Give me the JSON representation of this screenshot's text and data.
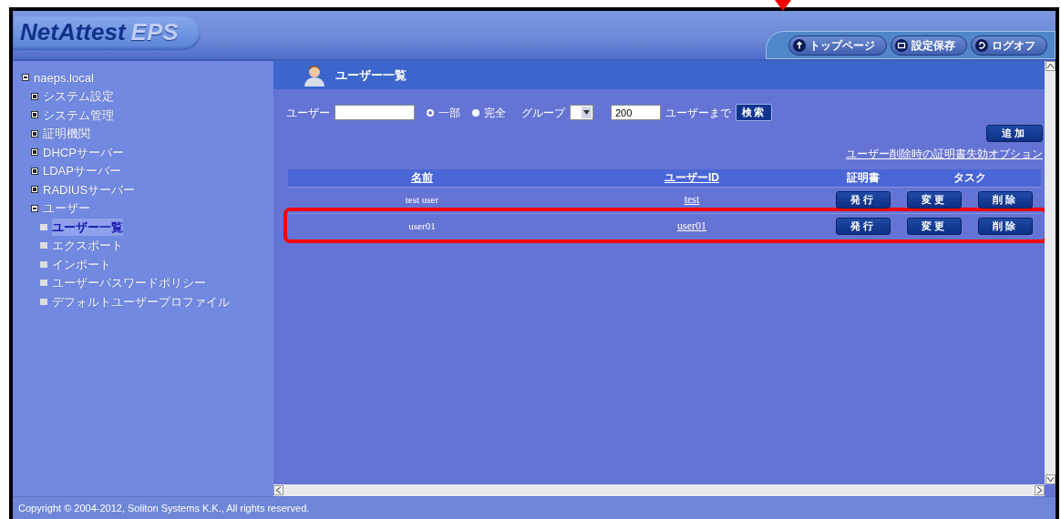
{
  "header": {
    "logo": {
      "main": "NetAttest",
      "sub": "EPS"
    },
    "nav_buttons": [
      {
        "label": "トップページ"
      },
      {
        "label": "設定保存"
      },
      {
        "label": "ログオフ"
      }
    ]
  },
  "sidebar": {
    "tree": [
      {
        "label": "naeps.local",
        "expanded": true,
        "selected": false,
        "children": [
          {
            "label": "システム設定",
            "expanded": false,
            "selected": false
          },
          {
            "label": "システム管理",
            "expanded": false,
            "selected": false
          },
          {
            "label": "証明機関",
            "expanded": false,
            "selected": false
          },
          {
            "label": "DHCPサーバー",
            "expanded": false,
            "selected": false
          },
          {
            "label": "LDAPサーバー",
            "expanded": false,
            "selected": false
          },
          {
            "label": "RADIUSサーバー",
            "expanded": false,
            "selected": false
          },
          {
            "label": "ユーザー",
            "expanded": true,
            "selected": false,
            "children": [
              {
                "label": "ユーザー一覧",
                "selected": true
              },
              {
                "label": "エクスポート",
                "selected": false
              },
              {
                "label": "インポート",
                "selected": false
              },
              {
                "label": "ユーザーパスワードポリシー",
                "selected": false
              },
              {
                "label": "デフォルトユーザープロファイル",
                "selected": false
              }
            ]
          }
        ]
      }
    ]
  },
  "page_title": "ユーザー一覧",
  "search": {
    "user_label": "ユーザー",
    "match_options": [
      {
        "label": "一部",
        "selected": true
      },
      {
        "label": "完全",
        "selected": false
      }
    ],
    "group_label": "グループ",
    "limit_value": "200",
    "limit_suffix": "ユーザーまで",
    "search_button": "検索"
  },
  "add_button": "追加",
  "revoke_option_link": "ユーザー削除時の証明書失効オプション",
  "table": {
    "columns": [
      {
        "label": "名前",
        "sortable": true
      },
      {
        "label": "ユーザーID",
        "sortable": true
      },
      {
        "label": "証明書",
        "sortable": false
      },
      {
        "label": "タスク",
        "sortable": false
      }
    ],
    "rows": [
      {
        "name": "test user",
        "user_id": "test",
        "highlighted": false,
        "actions": [
          "発行",
          "変更",
          "削除"
        ]
      },
      {
        "name": "user01",
        "user_id": "user01",
        "highlighted": true,
        "actions": [
          "発行",
          "変更",
          "削除"
        ]
      }
    ]
  },
  "status_bar": "Copyright © 2004-2012, Soliton Systems K.K., All rights reserved."
}
